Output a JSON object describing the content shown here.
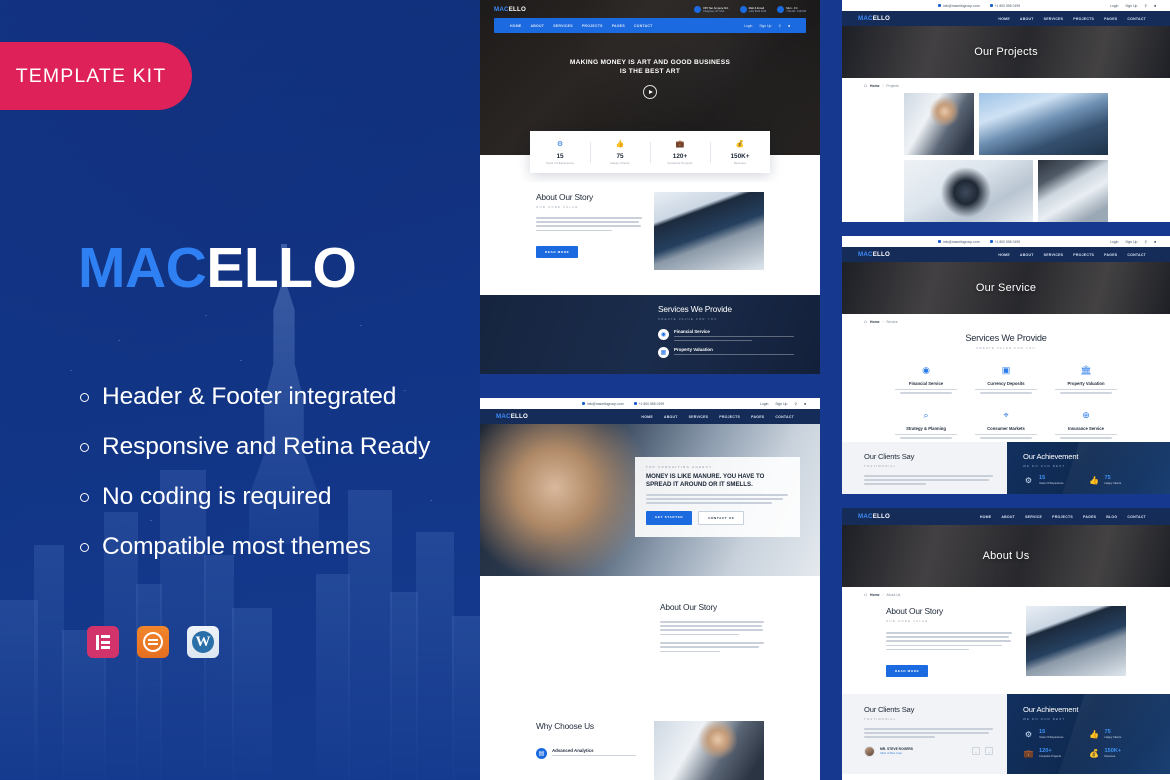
{
  "meta": {
    "accent_blue": "#2f80f2",
    "nav_dark": "#152b58",
    "badge_pink": "#de2158",
    "bg_navy": "#16398f",
    "button_blue": "#1b6ae0"
  },
  "hero": {
    "badge_label": "TEMPLATE KIT",
    "brand_first": "MAC",
    "brand_second": "ELLO",
    "features": [
      "Header & Footer integrated",
      "Responsive and Retina Ready",
      "No coding is required",
      "Compatible most themes"
    ],
    "plugins": [
      {
        "name": "Elementor",
        "glyph": "elementor-icon"
      },
      {
        "name": "Template Kit",
        "glyph": "template-kit-icon"
      },
      {
        "name": "WordPress",
        "glyph": "wordpress-icon",
        "letter": "W"
      }
    ]
  },
  "site": {
    "logo_first": "MAC",
    "logo_second": "ELLO",
    "nav": [
      "HOME",
      "ABOUT",
      "SERVICES",
      "PROJECTS",
      "PAGES",
      "CONTACT"
    ],
    "nav_alt": [
      "HOME",
      "ABOUT",
      "SERVICE",
      "PROJECTS",
      "PAGES",
      "BLOG",
      "CONTACT"
    ],
    "topbar": {
      "email": "info@macellogroup.com",
      "phone": "+1 800 555 0199",
      "login": "Login",
      "signup": "Sign Up",
      "search_icon": "search-icon",
      "cart_icon": "cart-icon"
    },
    "header_contacts": [
      {
        "icon": "map-pin-icon",
        "title": "155 Tan Ampere Rd.",
        "sub": "Chelgrove, NY USA"
      },
      {
        "icon": "phone-icon",
        "title": "Mail & Email",
        "sub": "(+01) 8100 1234"
      },
      {
        "icon": "clock-icon",
        "title": "Mon - Fri",
        "sub": "7:00 AM - 6:00 PM"
      }
    ]
  },
  "preview_home1": {
    "hero_title_line1": "MAKING MONEY IS ART AND GOOD BUSINESS",
    "hero_title_line2": "IS THE BEST ART",
    "play_icon": "play-icon",
    "stats": [
      {
        "icon": "gear-icon",
        "glyph": "⚙",
        "value": "15",
        "label": "Years Of Experience"
      },
      {
        "icon": "thumbs-up-icon",
        "glyph": "ὄD",
        "value": "75",
        "label": "Happy Clients"
      },
      {
        "icon": "briefcase-icon",
        "glyph": "ὋC",
        "value": "120+",
        "label": "Complete Projects"
      },
      {
        "icon": "dollar-icon",
        "glyph": "$",
        "value": "150K+",
        "label": "Revenue"
      }
    ],
    "about": {
      "title": "About Our Story",
      "subtitle": "OUR CORE VALUE",
      "button": "READ MORE"
    },
    "services": {
      "title": "Services We Provide",
      "subtitle": "CREATE VALUE FOR YOU",
      "items": [
        {
          "name": "Financial Service",
          "icon": "coin-icon"
        },
        {
          "name": "Property Valuation",
          "icon": "bank-icon"
        }
      ]
    }
  },
  "preview_home2": {
    "eyebrow": "TOP CONSULTING AGENCY",
    "hero_title_line1": "MONEY IS LIKE MANURE. YOU HAVE TO",
    "hero_title_line2": "SPREAD IT AROUND OR IT SMELLS.",
    "btn_primary": "GET STARTED",
    "btn_secondary": "CONTACT US",
    "about_title": "About Our Story",
    "why_title": "Why Choose Us",
    "why_items": [
      {
        "name": "Advanced Analytics",
        "icon": "chart-icon"
      }
    ],
    "play_icon": "play-icon"
  },
  "preview_projects": {
    "page_title": "Our Projects",
    "breadcrumb_home": "Home",
    "breadcrumb_current": "Projects",
    "tiles": [
      "project-board",
      "project-building",
      "project-phone",
      "project-laptop"
    ]
  },
  "preview_service": {
    "page_title": "Our Service",
    "breadcrumb_home": "Home",
    "breadcrumb_current": "Service",
    "section_title": "Services We Provide",
    "section_sub": "CREATE VALUE FOR YOU",
    "services": [
      {
        "name": "Financial Service",
        "icon": "coin-icon",
        "glyph": "◉"
      },
      {
        "name": "Currency Deposits",
        "icon": "deposit-icon",
        "glyph": "▣"
      },
      {
        "name": "Property Valuation",
        "icon": "bank-icon",
        "glyph": "ἽB"
      },
      {
        "name": "Strategy & Planning",
        "icon": "magnifier-icon",
        "glyph": "⌕"
      },
      {
        "name": "Consumer Markets",
        "icon": "globe-icon",
        "glyph": "⌖"
      },
      {
        "name": "Insurance Service",
        "icon": "shield-icon",
        "glyph": "⊕"
      }
    ],
    "clients_title": "Our Clients Say",
    "clients_sub": "TESTIMONIAL",
    "achieve_title": "Our Achievement",
    "achieve_sub": "WE DO OUR BEST",
    "achieve_stats": [
      {
        "icon": "gear-icon",
        "glyph": "⚙",
        "value": "15",
        "label": "Years Of Experience"
      },
      {
        "icon": "thumbs-up-icon",
        "glyph": "ὄD",
        "value": "75",
        "label": "Happy Clients"
      }
    ]
  },
  "preview_about": {
    "page_title": "About Us",
    "breadcrumb_home": "Home",
    "breadcrumb_current": "About Us",
    "about_title": "About Our Story",
    "about_sub": "OUR CORE VALUE",
    "about_button": "READ MORE",
    "clients_title": "Our Clients Say",
    "clients_sub": "TESTIMONIAL",
    "testimonial_name": "MR. STEVE ROGERS",
    "testimonial_role": "CEO of Mac Corp.",
    "achieve_title": "Our Achievement",
    "achieve_sub": "WE DO OUR BEST",
    "achieve_stats": [
      {
        "icon": "gear-icon",
        "glyph": "⚙",
        "value": "15",
        "label": "Years Of Experience"
      },
      {
        "icon": "thumbs-up-icon",
        "glyph": "ὄD",
        "value": "75",
        "label": "Happy Clients"
      },
      {
        "icon": "briefcase-icon",
        "glyph": "ὋC",
        "value": "120+",
        "label": "Complete Projects"
      },
      {
        "icon": "dollar-icon",
        "glyph": "$",
        "value": "150K+",
        "label": "Revenue"
      }
    ],
    "prev_icon": "arrow-left-icon",
    "next_icon": "arrow-right-icon"
  }
}
